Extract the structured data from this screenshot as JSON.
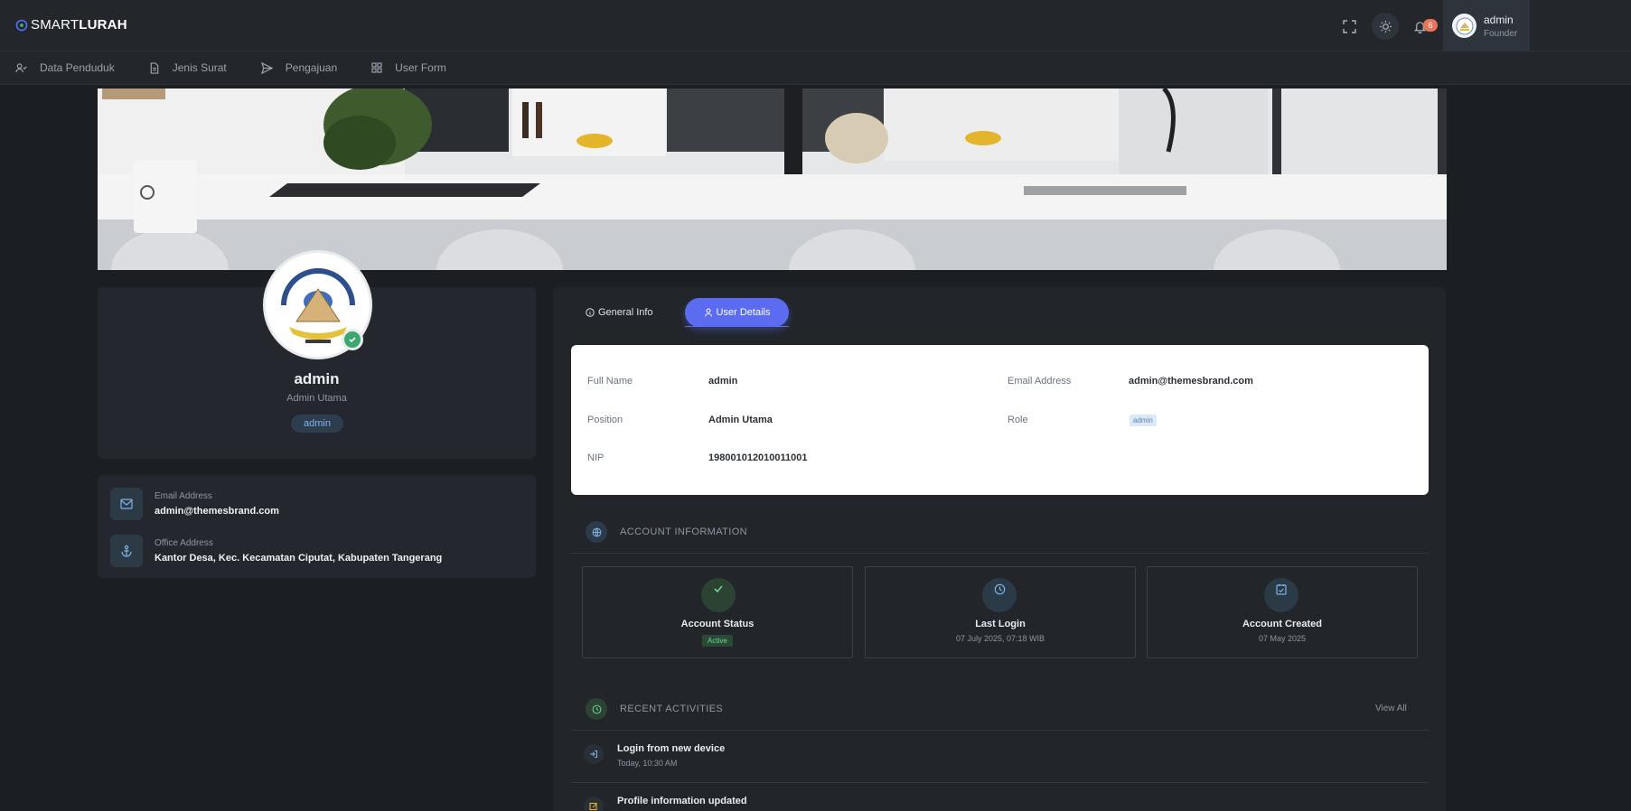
{
  "brand": {
    "part1": "SMART",
    "part2": "LURAH"
  },
  "topbar": {
    "icons": [
      "fullscreen-icon",
      "sun-icon",
      "bell-icon"
    ],
    "notification_count": "6",
    "user": {
      "name": "admin",
      "role": "Founder"
    }
  },
  "nav": {
    "items": [
      {
        "label": "Data Penduduk",
        "icon": "user-check-icon"
      },
      {
        "label": "Jenis Surat",
        "icon": "document-icon"
      },
      {
        "label": "Pengajuan",
        "icon": "send-icon"
      },
      {
        "label": "User Form",
        "icon": "grid-icon"
      }
    ]
  },
  "profile": {
    "name": "admin",
    "position": "Admin Utama",
    "badge": "admin",
    "email_label": "Email Address",
    "email": "admin@themesbrand.com",
    "office_label": "Office Address",
    "office": "Kantor Desa, Kec. Kecamatan Ciputat, Kabupaten Tangerang"
  },
  "tabs": {
    "general": "General Info",
    "details": "User Details"
  },
  "details": {
    "full_name_label": "Full Name",
    "full_name": "admin",
    "email_label": "Email Address",
    "email": "admin@themesbrand.com",
    "position_label": "Position",
    "position": "Admin Utama",
    "role_label": "Role",
    "role": "admin",
    "nip_label": "NIP",
    "nip": "198001012010011001"
  },
  "account": {
    "heading": "ACCOUNT INFORMATION",
    "status_title": "Account Status",
    "status_value": "Active",
    "login_title": "Last Login",
    "login_value": "07 July 2025, 07:18 WIB",
    "created_title": "Account Created",
    "created_value": "07 May 2025"
  },
  "activities": {
    "heading": "RECENT ACTIVITIES",
    "view_all": "View All",
    "items": [
      {
        "title": "Login from new device",
        "time": "Today, 10:30 AM"
      },
      {
        "title": "Profile information updated",
        "time": ""
      }
    ]
  },
  "colors": {
    "accent": "#5b6cf0",
    "background": "#1b1f23",
    "card": "#24282e",
    "success": "#3aa76d"
  }
}
